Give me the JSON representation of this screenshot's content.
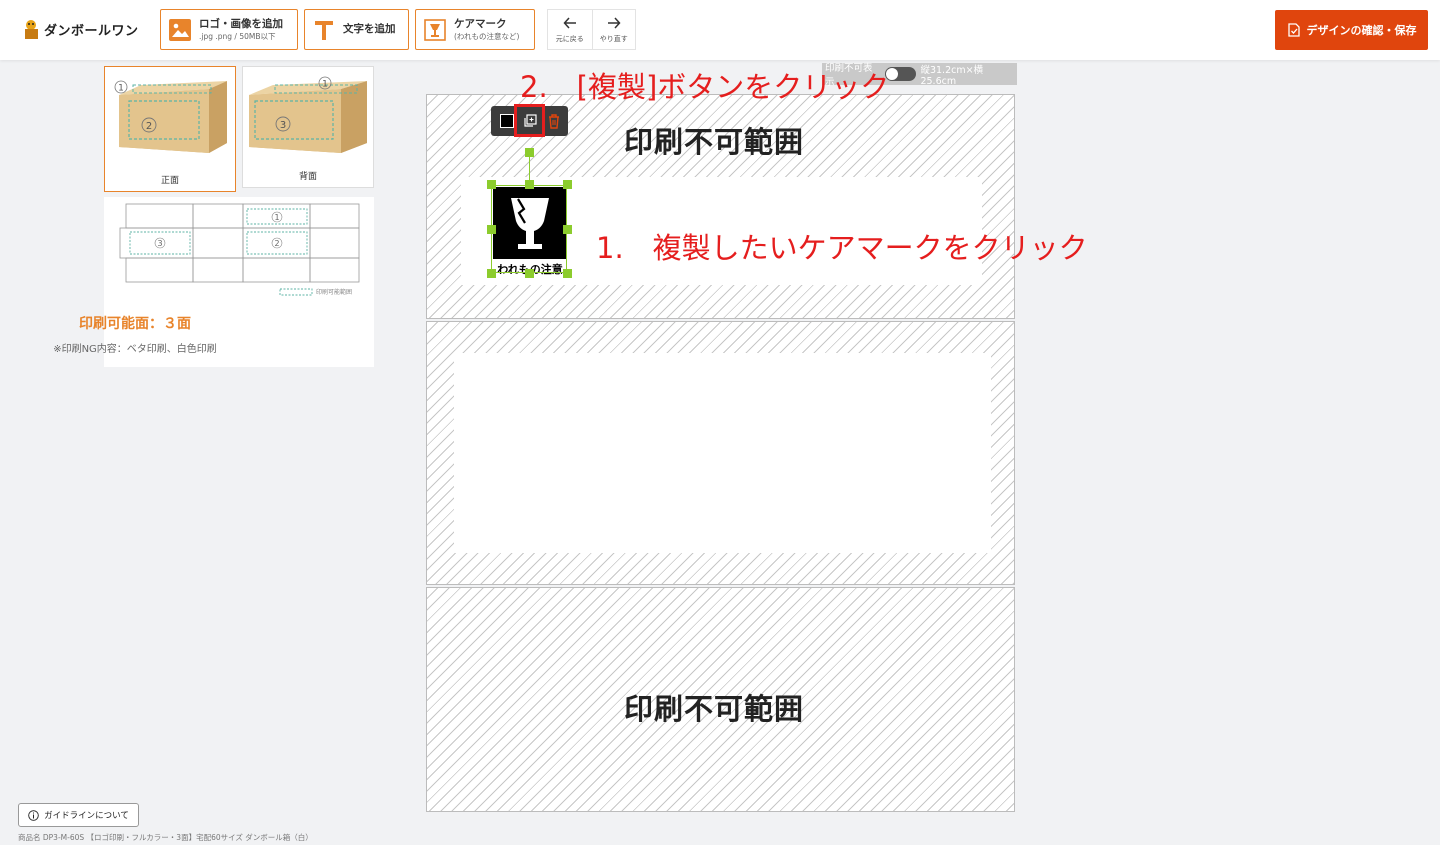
{
  "header": {
    "logo_text": "ダンボールワン",
    "add_image": {
      "label": "ロゴ・画像を追加",
      "sub": ".jpg .png / 50MB以下"
    },
    "add_text": {
      "label": "文字を追加"
    },
    "care_mark": {
      "label": "ケアマーク",
      "sub": "(われもの注意など)"
    },
    "undo_label": "元に戻る",
    "redo_label": "やり直す",
    "save_label": "デザインの確認・保存",
    "accent_color": "#e8842b",
    "save_color": "#e0450d"
  },
  "left_panel": {
    "faces": [
      {
        "label": "正面",
        "active": true
      },
      {
        "label": "背面",
        "active": false
      }
    ],
    "net_legend": "印刷可能範囲",
    "printable_title": "印刷可能面：３面",
    "printable_note": "※印刷NG内容：ベタ印刷、白色印刷"
  },
  "canvas": {
    "toggle_label": "印刷不可表示",
    "dimensions": "縦31.2cm×横25.6cm",
    "noprint_label": "印刷不可範囲",
    "care_mark_text": "われもの注意"
  },
  "annotations": {
    "step1": "1.　複製したいケアマークをクリック",
    "step2": "2.　[複製]ボタンをクリック"
  },
  "footer": {
    "guide_label": "ガイドラインについて",
    "product_info": "商品名 DP3-M-60S 【ロゴ印刷・フルカラー・3面】宅配60サイズ ダンボール箱（白）"
  }
}
